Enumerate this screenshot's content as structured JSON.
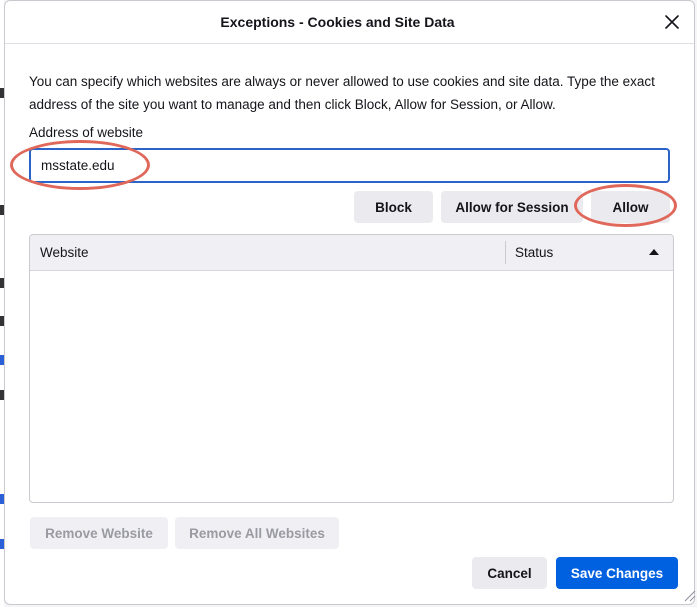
{
  "dialog": {
    "title": "Exceptions - Cookies and Site Data",
    "description": "You can specify which websites are always or never allowed to use cookies and site data. Type the exact address of the site you want to manage and then click Block, Allow for Session, or Allow.",
    "address_label": "Address of website",
    "address_value": "msstate.edu",
    "close_icon": "close-icon"
  },
  "actions": {
    "block_label": "Block",
    "allow_session_label": "Allow for Session",
    "allow_label": "Allow"
  },
  "table": {
    "columns": [
      "Website",
      "Status"
    ],
    "sort_icon": "sort-ascending-icon",
    "rows": []
  },
  "list_actions": {
    "remove_label": "Remove Website",
    "remove_all_label": "Remove All Websites"
  },
  "footer": {
    "cancel_label": "Cancel",
    "save_label": "Save Changes"
  },
  "colors": {
    "accent": "#0061e0",
    "focus_border": "#2b63c9",
    "annotation": "#e0685a"
  }
}
